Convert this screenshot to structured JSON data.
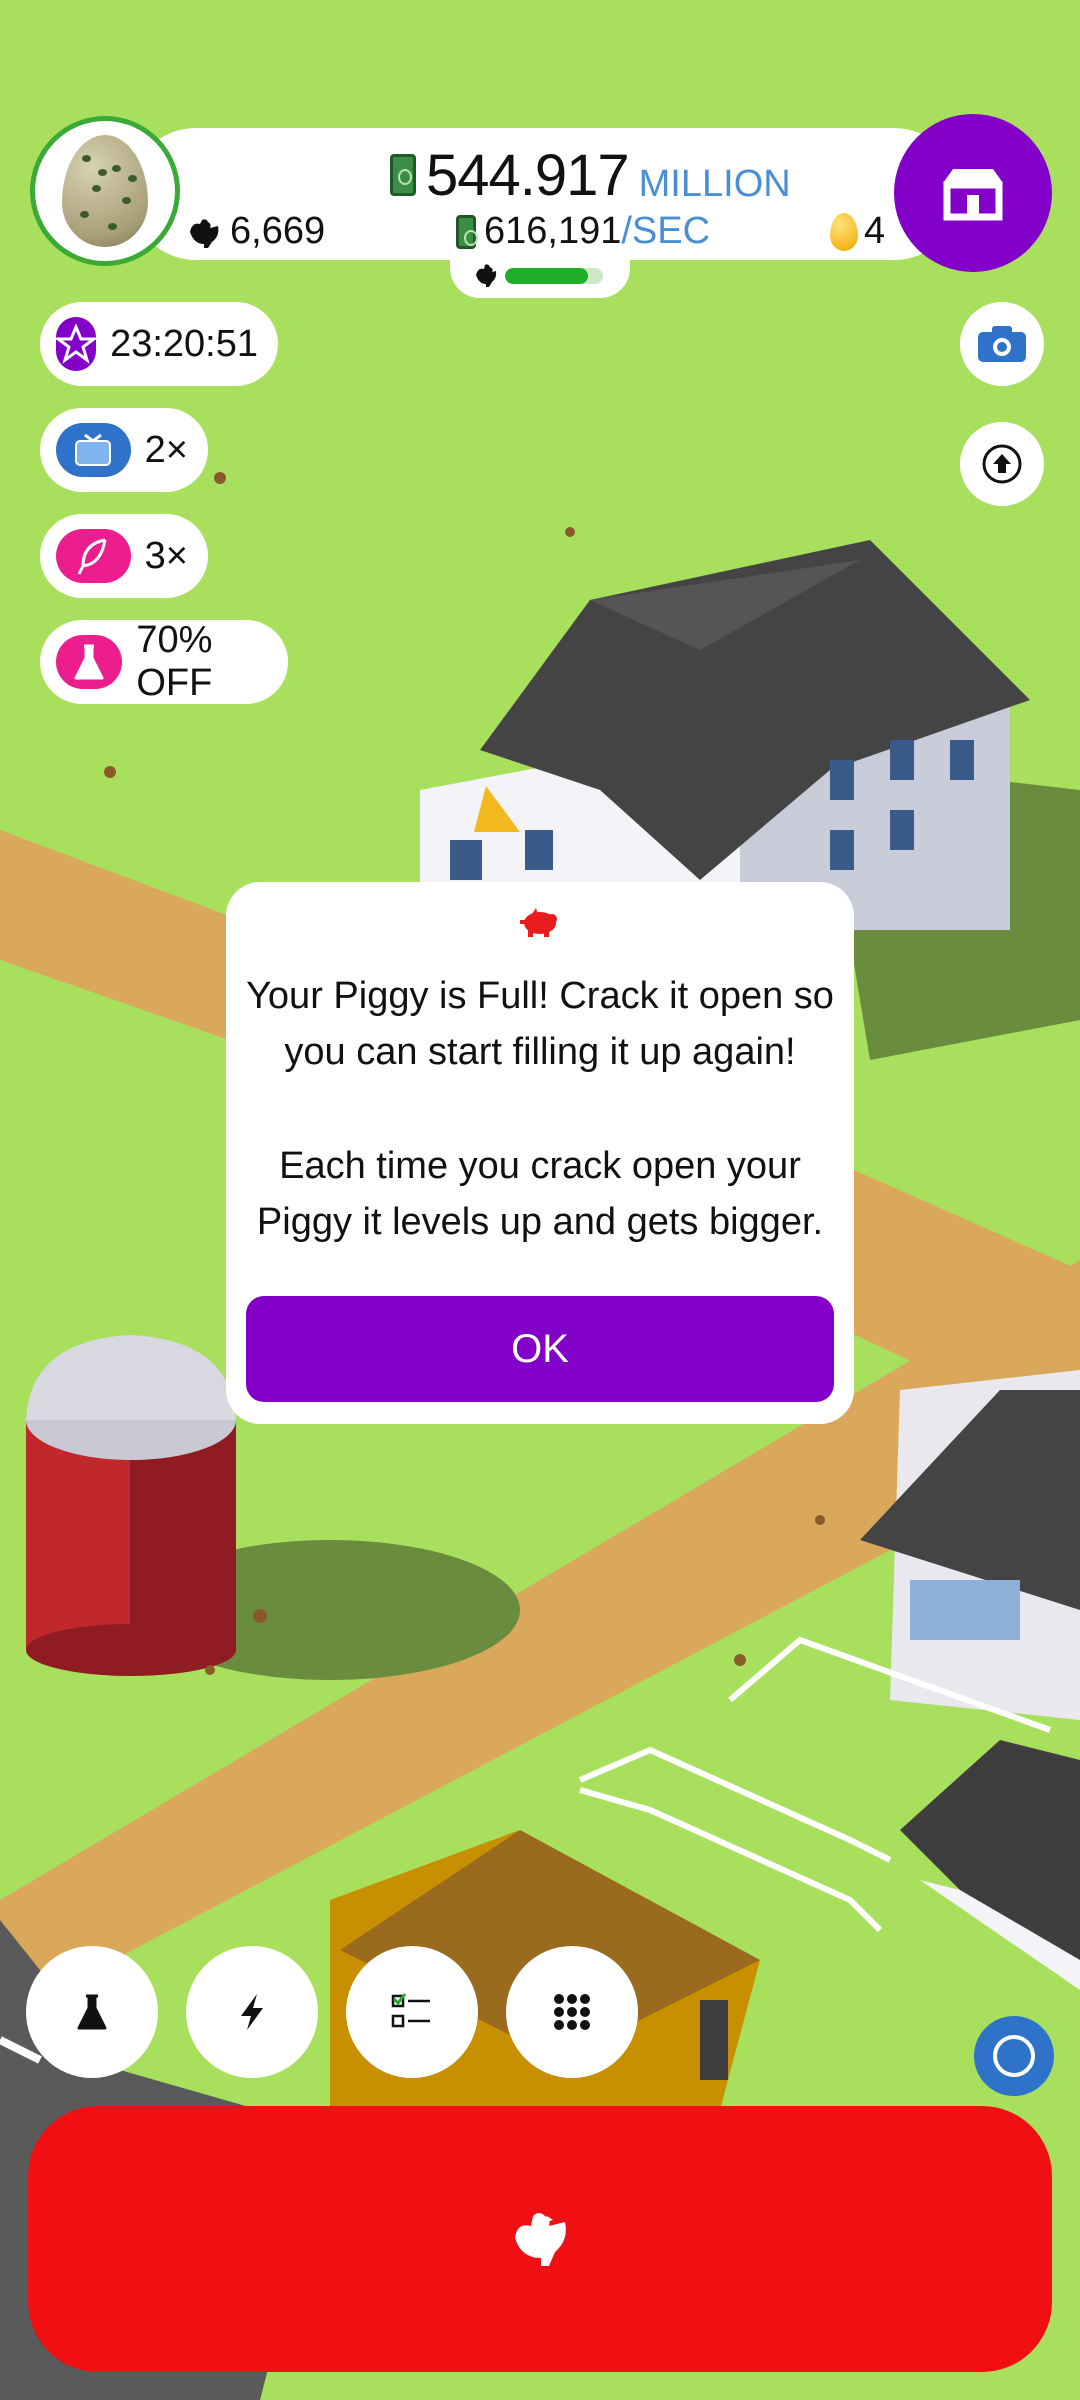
{
  "colors": {
    "grass": "#a8e05d",
    "dirt_road": "#d9a85a",
    "accent_purple": "#8200c8",
    "hatch_red": "#f00f12",
    "progress_green": "#1fae2a",
    "money_unit_blue": "#4a8ed6"
  },
  "header": {
    "avatar_icon": "quail-egg-icon",
    "money_value": "544.917",
    "money_unit": "MILLION",
    "rate_value": "616,191",
    "rate_unit": "/SEC",
    "chicken_count": "6,669",
    "golden_egg_count": "4",
    "shop_icon": "shop-icon",
    "hen_house_progress": 0.85
  },
  "boosts": [
    {
      "icon": "star-icon",
      "label": "23:20:51",
      "color": "#8200c8"
    },
    {
      "icon": "tv-icon",
      "label": "2×",
      "color": "#2e73c9"
    },
    {
      "icon": "feather-icon",
      "label": "3×",
      "color": "#ec1d8c"
    },
    {
      "icon": "flask-icon",
      "label": "70% OFF",
      "color": "#ec1d8c"
    }
  ],
  "side_buttons": {
    "camera_icon": "camera-icon",
    "upgrade_icon": "arrow-up-circle-icon"
  },
  "dialog": {
    "icon": "piggy-bank-icon",
    "paragraph1_line1": "Your Piggy is Full! Crack it open so",
    "paragraph1_line2": "you can start filling it up again!",
    "paragraph2_line1": "Each time you crack open your",
    "paragraph2_line2": "Piggy it levels up and gets bigger.",
    "ok_label": "OK"
  },
  "toolbar": [
    {
      "icon": "flask-icon"
    },
    {
      "icon": "lightning-icon"
    },
    {
      "icon": "checklist-icon"
    },
    {
      "icon": "grid-dots-icon"
    }
  ],
  "hatch_button": {
    "icon": "chicken-icon"
  },
  "corner_button": {
    "icon": "circle-icon"
  }
}
